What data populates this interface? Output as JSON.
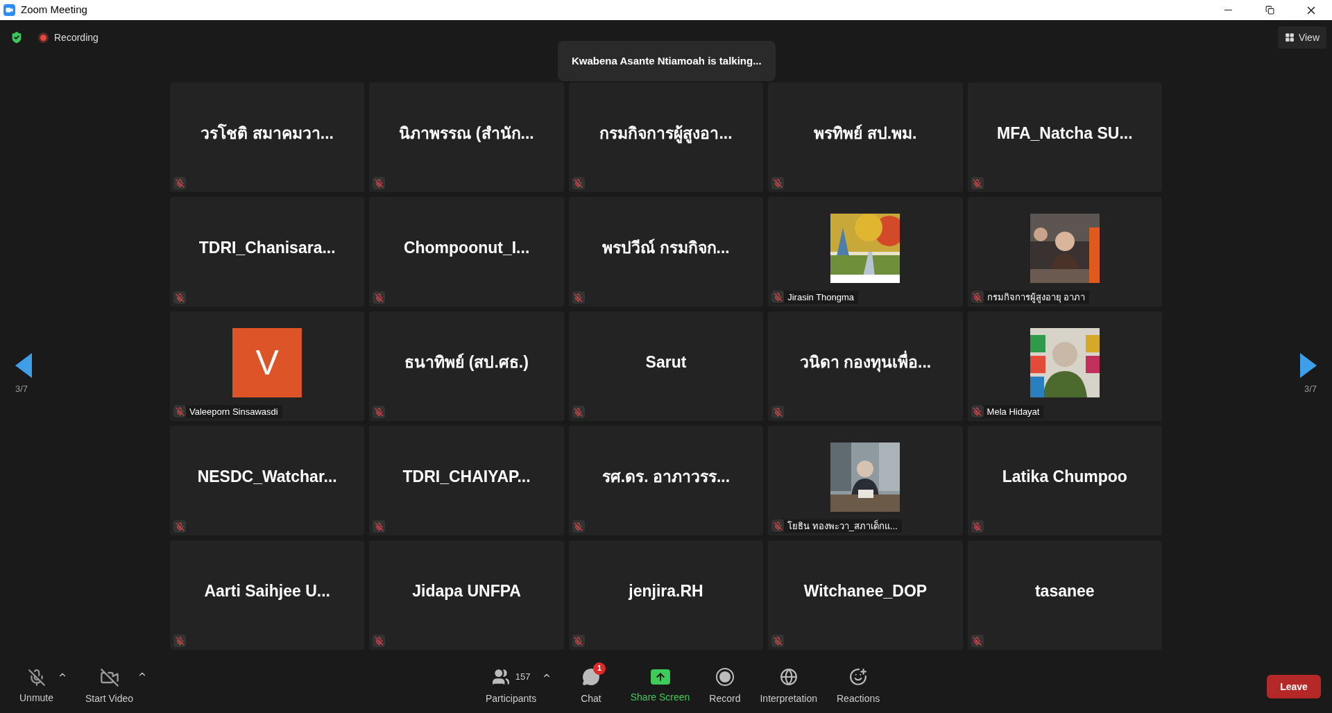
{
  "window": {
    "title": "Zoom Meeting"
  },
  "top_bar": {
    "recording": "Recording",
    "talking": "Kwabena Asante Ntiamoah is talking...",
    "view": "View"
  },
  "pager": {
    "left": "3/7",
    "right": "3/7"
  },
  "tiles": [
    {
      "kind": "name",
      "name": "วรโชติ สมาคมวา...",
      "muted": true
    },
    {
      "kind": "name",
      "name": "นิภาพรรณ (สำนัก...",
      "muted": true
    },
    {
      "kind": "name",
      "name": "กรมกิจการผู้สูงอา...",
      "muted": true
    },
    {
      "kind": "name",
      "name": "พรทิพย์ สป.พม.",
      "muted": true
    },
    {
      "kind": "name",
      "name": "MFA_Natcha  SU...",
      "muted": true
    },
    {
      "kind": "name",
      "name": "TDRI_Chanisara...",
      "muted": true
    },
    {
      "kind": "name",
      "name": "Chompoonut_I...",
      "muted": true
    },
    {
      "kind": "name",
      "name": "พรปวีณ์ กรมกิจก...",
      "muted": true
    },
    {
      "kind": "video",
      "name": "Jirasin Thongma",
      "muted": true
    },
    {
      "kind": "video",
      "name": "กรมกิจการผู้สูงอายุ อาภา",
      "muted": true
    },
    {
      "kind": "avatar",
      "initial": "V",
      "name": "Valeeporn Sinsawasdi",
      "muted": true
    },
    {
      "kind": "name",
      "name": "ธนาทิพย์ (สป.ศธ.)",
      "muted": true
    },
    {
      "kind": "name",
      "name": "Sarut",
      "muted": true
    },
    {
      "kind": "name",
      "name": "วนิดา กองทุนเพื่อ...",
      "muted": true
    },
    {
      "kind": "video",
      "name": "Mela Hidayat",
      "muted": true
    },
    {
      "kind": "name",
      "name": "NESDC_Watchar...",
      "muted": true
    },
    {
      "kind": "name",
      "name": "TDRI_CHAIYAP...",
      "muted": true
    },
    {
      "kind": "name",
      "name": "รศ.ดร. อาภาวรร...",
      "muted": true
    },
    {
      "kind": "video",
      "name": "โยธิน ทองพะวา_สภาเด็กแ...",
      "muted": true
    },
    {
      "kind": "name",
      "name": "Latika Chumpoo",
      "muted": true
    },
    {
      "kind": "name",
      "name": "Aarti  Saihjee  U...",
      "muted": true
    },
    {
      "kind": "name",
      "name": "Jidapa UNFPA",
      "muted": true
    },
    {
      "kind": "name",
      "name": "jenjira.RH",
      "muted": true
    },
    {
      "kind": "name",
      "name": "Witchanee_DOP",
      "muted": true
    },
    {
      "kind": "name",
      "name": "tasanee",
      "muted": true
    }
  ],
  "left_controls": [
    {
      "kind": "mic",
      "label": "Unmute",
      "off": true
    },
    {
      "kind": "camera",
      "label": "Start Video",
      "off": true
    }
  ],
  "center_controls": [
    {
      "kind": "participants",
      "label": "Participants",
      "count": "157"
    },
    {
      "kind": "chat",
      "label": "Chat",
      "badge": "1"
    },
    {
      "kind": "share",
      "label": "Share Screen"
    },
    {
      "kind": "record",
      "label": "Record"
    },
    {
      "kind": "interpretation",
      "label": "Interpretation"
    },
    {
      "kind": "reactions",
      "label": "Reactions"
    }
  ],
  "leave": "Leave"
}
